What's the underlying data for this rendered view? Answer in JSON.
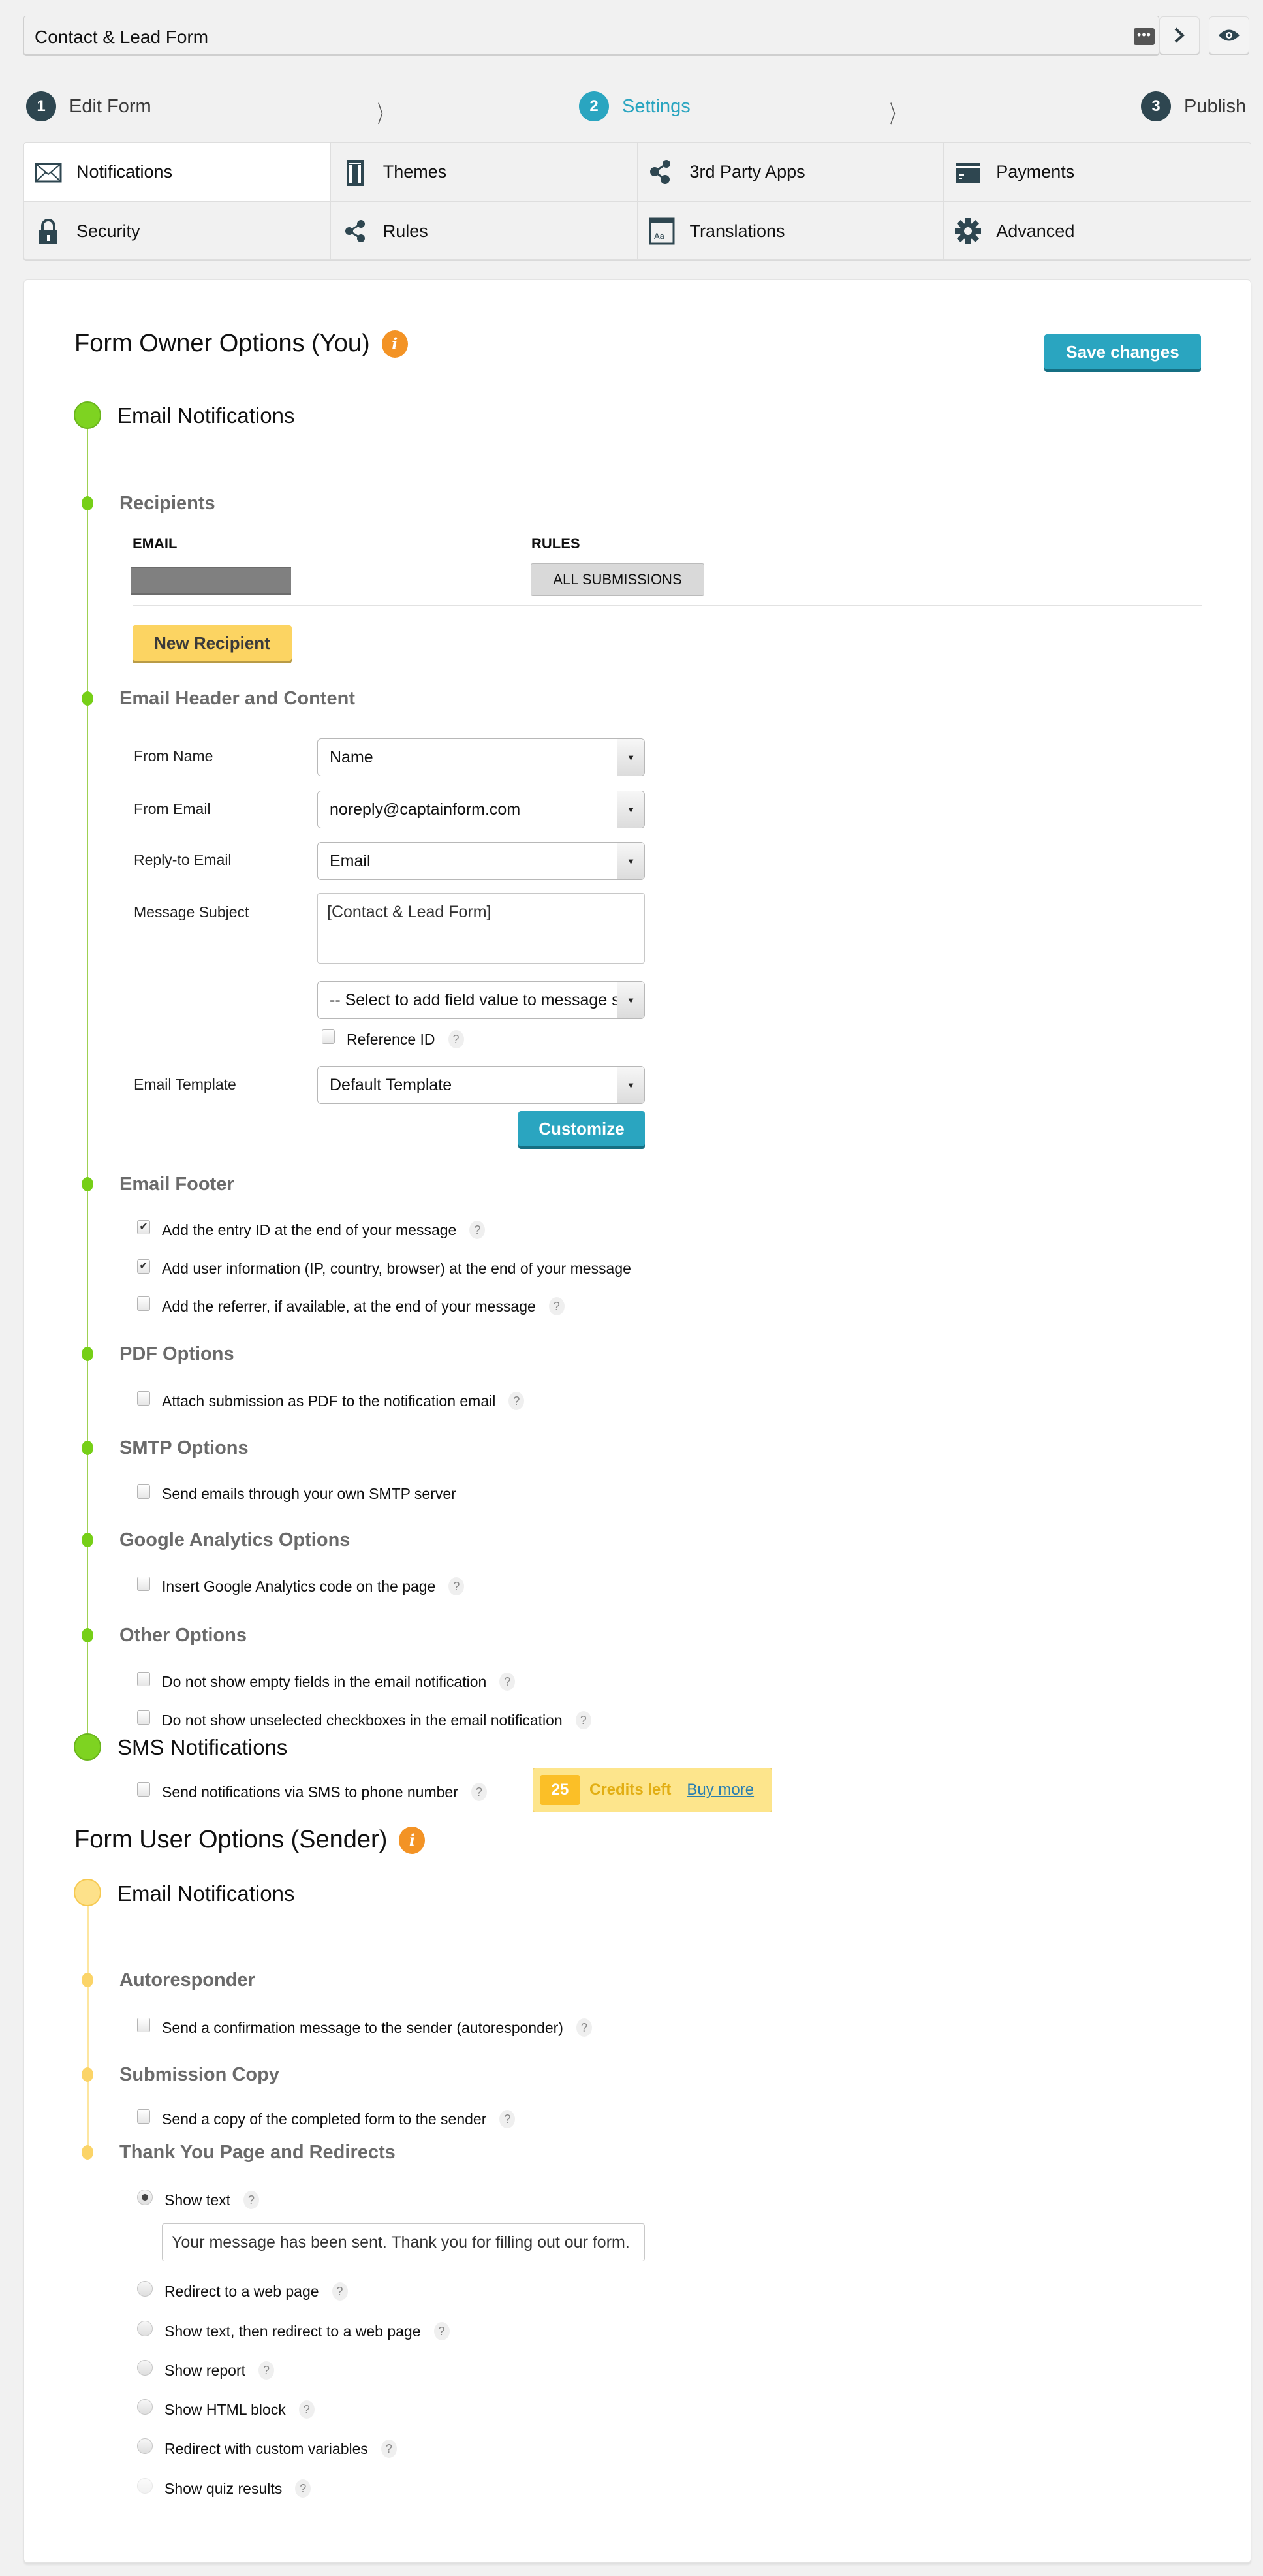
{
  "header": {
    "form_title": "Contact & Lead Form",
    "more_icon": "ellipsis-icon",
    "next_icon": "chevron-right-icon",
    "preview_icon": "eye-icon"
  },
  "wizard": {
    "steps": [
      {
        "num": "1",
        "label": "Edit Form",
        "active": false
      },
      {
        "num": "2",
        "label": "Settings",
        "active": true
      },
      {
        "num": "3",
        "label": "Publish",
        "active": false
      }
    ]
  },
  "tabs": [
    {
      "label": "Notifications",
      "icon": "envelope-icon",
      "active": true
    },
    {
      "label": "Themes",
      "icon": "theme-icon",
      "active": false
    },
    {
      "label": "3rd Party Apps",
      "icon": "apps-icon",
      "active": false
    },
    {
      "label": "Payments",
      "icon": "payment-card-icon",
      "active": false
    },
    {
      "label": "Security",
      "icon": "lock-icon",
      "active": false
    },
    {
      "label": "Rules",
      "icon": "share-icon",
      "active": false
    },
    {
      "label": "Translations",
      "icon": "translate-icon",
      "active": false
    },
    {
      "label": "Advanced",
      "icon": "gear-icon",
      "active": false
    }
  ],
  "owner": {
    "heading": "Form Owner Options (You)",
    "info_icon": "i",
    "save_label": "Save changes",
    "email_notifications": "Email Notifications",
    "recipients": {
      "heading": "Recipients",
      "col_email": "EMAIL",
      "col_rules": "RULES",
      "rows": [
        {
          "email": "",
          "rule": "ALL SUBMISSIONS"
        }
      ],
      "new_label": "New Recipient"
    },
    "header_content": {
      "heading": "Email Header and Content",
      "from_name_label": "From Name",
      "from_name_value": "Name",
      "from_email_label": "From Email",
      "from_email_value": "noreply@captainform.com",
      "reply_to_label": "Reply-to Email",
      "reply_to_value": "Email",
      "subject_label": "Message Subject",
      "subject_value": "[Contact & Lead Form]",
      "field_select_value": "-- Select to add field value to message subject --",
      "reference_id_label": "Reference ID",
      "reference_id_checked": false,
      "template_label": "Email Template",
      "template_value": "Default Template",
      "customize_label": "Customize"
    },
    "footer": {
      "heading": "Email Footer",
      "options": [
        {
          "label": "Add the entry ID at the end of your message",
          "checked": true,
          "help": true
        },
        {
          "label": "Add user information (IP, country, browser) at the end of your message",
          "checked": true,
          "help": false
        },
        {
          "label": "Add the referrer, if available, at the end of your message",
          "checked": false,
          "help": true
        }
      ]
    },
    "pdf": {
      "heading": "PDF Options",
      "option": "Attach submission as PDF to the notification email",
      "checked": false
    },
    "smtp": {
      "heading": "SMTP Options",
      "option": "Send emails through your own SMTP server",
      "checked": false
    },
    "ga": {
      "heading": "Google Analytics Options",
      "option": "Insert Google Analytics code on the page",
      "checked": false
    },
    "other": {
      "heading": "Other Options",
      "options": [
        {
          "label": "Do not show empty fields in the email notification",
          "checked": false
        },
        {
          "label": "Do not show unselected checkboxes in the email notification",
          "checked": false
        }
      ]
    },
    "sms": {
      "heading": "SMS Notifications",
      "option": "Send notifications via SMS to phone number",
      "checked": false,
      "credits": "25",
      "credits_label": "Credits left",
      "buy_label": "Buy more"
    }
  },
  "sender": {
    "heading": "Form User Options (Sender)",
    "info_icon": "i",
    "email_notifications": "Email Notifications",
    "autoresponder": {
      "heading": "Autoresponder",
      "option": "Send a confirmation message to the sender (autoresponder)",
      "checked": false
    },
    "copy": {
      "heading": "Submission Copy",
      "option": "Send a copy of the completed form to the sender",
      "checked": false
    },
    "thankyou": {
      "heading": "Thank You Page and Redirects",
      "message_value": "Your message has been sent. Thank you for filling out our form.",
      "options": [
        {
          "label": "Show text",
          "selected": true
        },
        {
          "label": "Redirect to a web page",
          "selected": false
        },
        {
          "label": "Show text, then redirect to a web page",
          "selected": false
        },
        {
          "label": "Show report",
          "selected": false
        },
        {
          "label": "Show HTML block",
          "selected": false
        },
        {
          "label": "Redirect with custom variables",
          "selected": false
        },
        {
          "label": "Show quiz results",
          "selected": false
        }
      ]
    }
  },
  "colors": {
    "accent": "#2aa5c0",
    "owner_timeline": "#7ed321",
    "sender_timeline": "#fde18a",
    "info_badge": "#f39325",
    "new_recipient": "#fcd462"
  }
}
